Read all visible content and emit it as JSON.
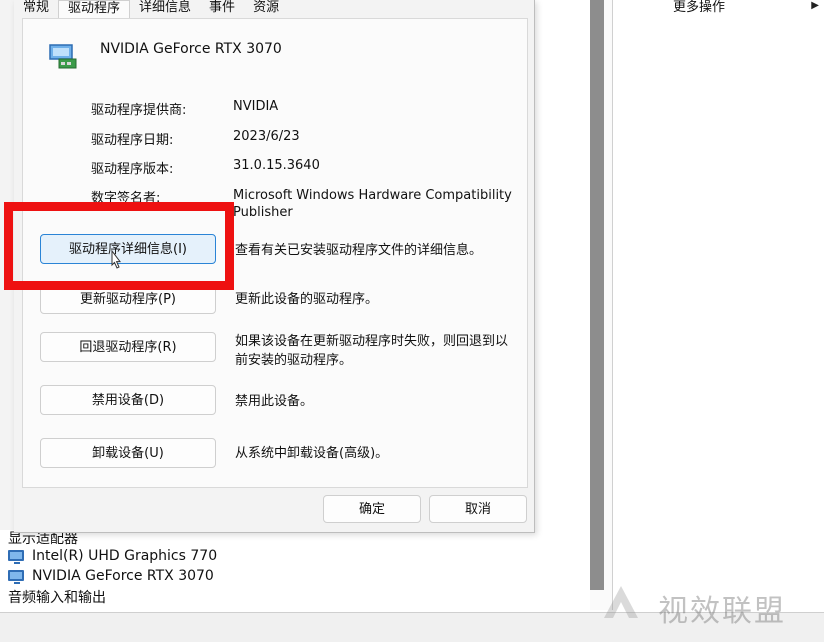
{
  "tabs": [
    {
      "label": "常规"
    },
    {
      "label": "驱动程序"
    },
    {
      "label": "详细信息"
    },
    {
      "label": "事件"
    },
    {
      "label": "资源"
    }
  ],
  "device_name": "NVIDIA GeForce RTX 3070",
  "properties": [
    {
      "label": "驱动程序提供商:",
      "value": "NVIDIA"
    },
    {
      "label": "驱动程序日期:",
      "value": "2023/6/23"
    },
    {
      "label": "驱动程序版本:",
      "value": "31.0.15.3640"
    },
    {
      "label": "数字签名者:",
      "value": "Microsoft Windows Hardware Compatibility Publisher"
    }
  ],
  "actions": [
    {
      "button": "驱动程序详细信息(I)",
      "desc": "查看有关已安装驱动程序文件的详细信息。"
    },
    {
      "button": "更新驱动程序(P)",
      "desc": "更新此设备的驱动程序。"
    },
    {
      "button": "回退驱动程序(R)",
      "desc": "如果该设备在更新驱动程序时失败，则回退到以前安装的驱动程序。"
    },
    {
      "button": "禁用设备(D)",
      "desc": "禁用此设备。"
    },
    {
      "button": "卸载设备(U)",
      "desc": "从系统中卸载设备(高级)。"
    }
  ],
  "footer": {
    "ok": "确定",
    "cancel": "取消"
  },
  "side_panel": {
    "more_actions": "更多操作"
  },
  "tree": {
    "category": "显示适配器",
    "items": [
      "Intel(R) UHD Graphics 770",
      "NVIDIA GeForce RTX 3070"
    ],
    "next_category": "音频输入和输出"
  },
  "watermark": "视效联盟",
  "colors": {
    "highlight": "#ee1111",
    "focus": "#2a84d6"
  }
}
